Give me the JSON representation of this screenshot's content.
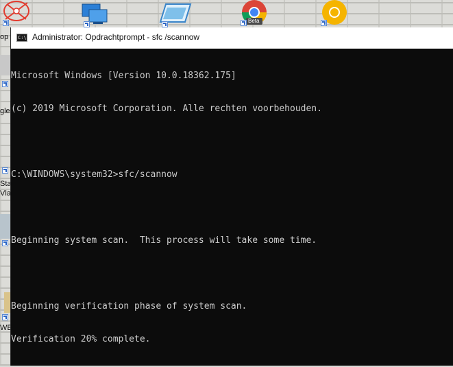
{
  "window": {
    "title": "Administrator: Opdrachtprompt - sfc /scannow",
    "icon_label": "C:\\"
  },
  "desktop": {
    "icons": [
      {
        "name": "network-icon",
        "color": "#e23b2e"
      },
      {
        "name": "remote-desktop-icon",
        "color": "#2b7fd6"
      },
      {
        "name": "window-app-icon",
        "color": "#5aa6e0"
      },
      {
        "name": "chrome-beta-icon",
        "badge": "Beta"
      },
      {
        "name": "chrome-canary-icon",
        "color": "#f5b400"
      }
    ],
    "partial_labels": [
      "op",
      "gle",
      "Sta",
      "Vlaa",
      "WE"
    ]
  },
  "console": {
    "lines": [
      "Microsoft Windows [Version 10.0.18362.175]",
      "(c) 2019 Microsoft Corporation. Alle rechten voorbehouden.",
      "",
      "C:\\WINDOWS\\system32>sfc/scannow",
      "",
      "Beginning system scan.  This process will take some time.",
      "",
      "Beginning verification phase of system scan.",
      "Verification 20% complete."
    ],
    "text_color": "#cccccc",
    "background_color": "#0c0c0c"
  }
}
